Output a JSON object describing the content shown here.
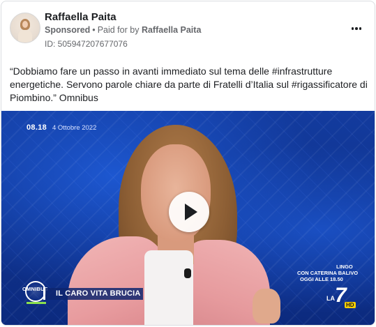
{
  "post": {
    "page_name": "Raffaella Paita",
    "sponsored_label": "Sponsored",
    "separator": "•",
    "paid_for_prefix": "Paid for by",
    "payer": "Raffaella Paita",
    "ad_id": "ID: 505947207677076",
    "text": "“Dobbiamo fare un passo in avanti immediato sul tema delle #infrastrutture energetiche. Servono parole chiare da parte di Fratelli d’Italia sul #rigassificatore di Piombino.” Omnibus",
    "more_icon": "more-horizontal-icon"
  },
  "video": {
    "time": "08.18",
    "date": "4 Ottobre 2022",
    "show_logo": "OMNIBUS",
    "banner": "IL CARO VITA BRUCIA",
    "promo_show": "LINGO",
    "promo_host": "CON CATERINA BALIVO",
    "promo_time": "OGGI ALLE 18.50",
    "channel_la": "LA",
    "channel_number": "7",
    "channel_hd": "HD",
    "play_icon": "play-icon"
  },
  "colors": {
    "text_primary": "#1c1e21",
    "text_secondary": "#65676b",
    "video_blue": "#133b9e",
    "jacket_pink": "#e89c9f"
  }
}
